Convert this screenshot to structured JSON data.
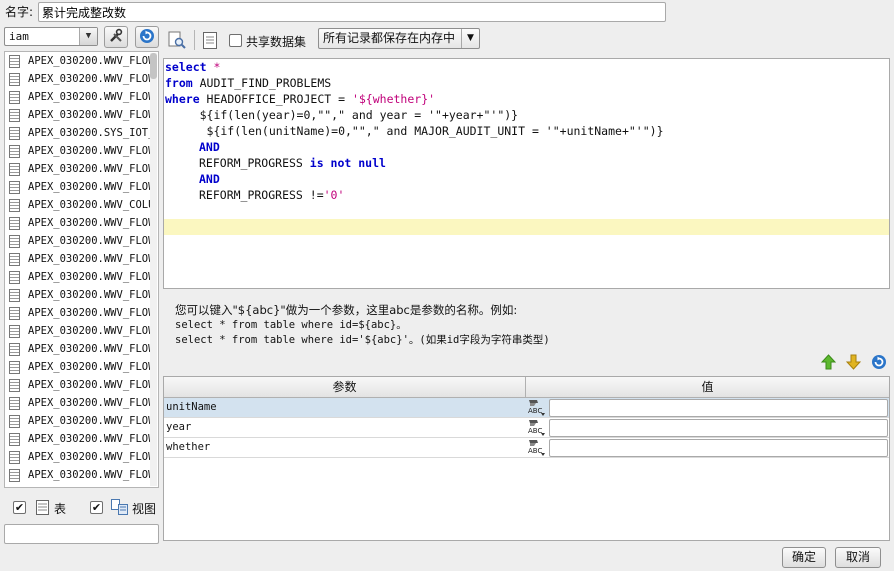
{
  "name_label": "名字:",
  "name_value": "累计完成整改数",
  "schema": "iam",
  "share_label": "共享数据集",
  "record_mode": "所有记录都保存在内存中",
  "tables": [
    "APEX_030200.WWV_FLOW_",
    "APEX_030200.WWV_FLOW_",
    "APEX_030200.WWV_FLOW_",
    "APEX_030200.WWV_FLOW_",
    "APEX_030200.SYS_IOT_(",
    "APEX_030200.WWV_FLOW_",
    "APEX_030200.WWV_FLOW_",
    "APEX_030200.WWV_FLOW_",
    "APEX_030200.WWV_COLUM",
    "APEX_030200.WWV_FLOW_",
    "APEX_030200.WWV_FLOW_",
    "APEX_030200.WWV_FLOW_",
    "APEX_030200.WWV_FLOW_",
    "APEX_030200.WWV_FLOW_",
    "APEX_030200.WWV_FLOW_",
    "APEX_030200.WWV_FLOW_",
    "APEX_030200.WWV_FLOW_",
    "APEX_030200.WWV_FLOW_",
    "APEX_030200.WWV_FLOW_",
    "APEX_030200.WWV_FLOW_",
    "APEX_030200.WWV_FLOW_",
    "APEX_030200.WWV_FLOW_",
    "APEX_030200.WWV_FLOW_",
    "APEX_030200.WWV_FLOW_"
  ],
  "table_check_label": "表",
  "view_check_label": "视图",
  "sql": {
    "l1_kw": "select",
    "l1_rest": " *",
    "l2_kw": "from",
    "l2_rest": " AUDIT_FIND_PROBLEMS",
    "l3_kw": "where",
    "l3_a": " HEADOFFICE_PROJECT = ",
    "l3_str": "'${whether}'",
    "l4": "     ${if(len(year)=0,\"\",\" and year = '\"+year+\"'\")}",
    "l5": "      ${if(len(unitName)=0,\"\",\" and MAJOR_AUDIT_UNIT = '\"+unitName+\"'\")}",
    "l6": "AND",
    "l7_a": "REFORM_PROGRESS ",
    "l7_kw": "is not null",
    "l8": "AND",
    "l9_a": "REFORM_PROGRESS !=",
    "l9_str": "'0'"
  },
  "hint": {
    "line1": "您可以键入\"${abc}\"做为一个参数，这里abc是参数的名称。例如:",
    "line2": "select * from table where id=${abc}。",
    "line3": "select * from table where id='${abc}'。(如果id字段为字符串类型)"
  },
  "param_grid": {
    "col_param": "参数",
    "col_value": "值",
    "rows": [
      {
        "name": "unitName",
        "value": ""
      },
      {
        "name": "year",
        "value": ""
      },
      {
        "name": "whether",
        "value": ""
      }
    ]
  },
  "ok_label": "确定",
  "cancel_label": "取消",
  "colors": {
    "selected_row": "#d3e2ef",
    "current_line": "#fbf7c0",
    "keyword": "#0000cc",
    "string": "#c0007a"
  }
}
